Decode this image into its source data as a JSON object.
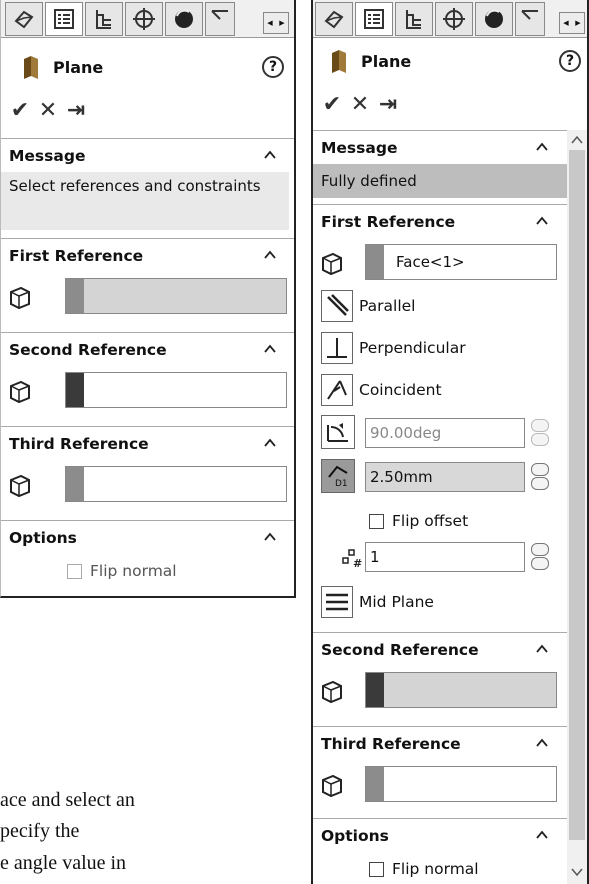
{
  "background_text": [
    "ace and select an",
    "pecify the",
    "e angle value in"
  ],
  "panel_a": {
    "title": "Plane",
    "help": "?",
    "actions": {
      "ok": "✔",
      "cancel": "✕",
      "pin": "⇥"
    },
    "message": {
      "header": "Message",
      "text": "Select references and constraints"
    },
    "first_ref": {
      "header": "First Reference"
    },
    "second_ref": {
      "header": "Second Reference"
    },
    "third_ref": {
      "header": "Third Reference"
    },
    "options": {
      "header": "Options",
      "flip_normal": "Flip normal"
    }
  },
  "panel_b": {
    "title": "Plane",
    "help": "?",
    "actions": {
      "ok": "✔",
      "cancel": "✕",
      "pin": "⇥"
    },
    "message": {
      "header": "Message",
      "text": "Fully defined"
    },
    "first_ref": {
      "header": "First Reference",
      "value": "Face<1>",
      "parallel": "Parallel",
      "perpendicular": "Perpendicular",
      "coincident": "Coincident",
      "angle": "90.00deg",
      "offset": "2.50mm",
      "flip_offset": "Flip offset",
      "instances": "1",
      "mid_plane": "Mid Plane"
    },
    "second_ref": {
      "header": "Second Reference"
    },
    "third_ref": {
      "header": "Third Reference"
    },
    "options": {
      "header": "Options",
      "flip_normal": "Flip normal"
    }
  },
  "colors": {
    "swatch_pink": "#8c8c8c",
    "swatch_dark": "#3a3a3a",
    "highlight": "#bdbdbd",
    "msg_bg": "#e9e9e9"
  }
}
